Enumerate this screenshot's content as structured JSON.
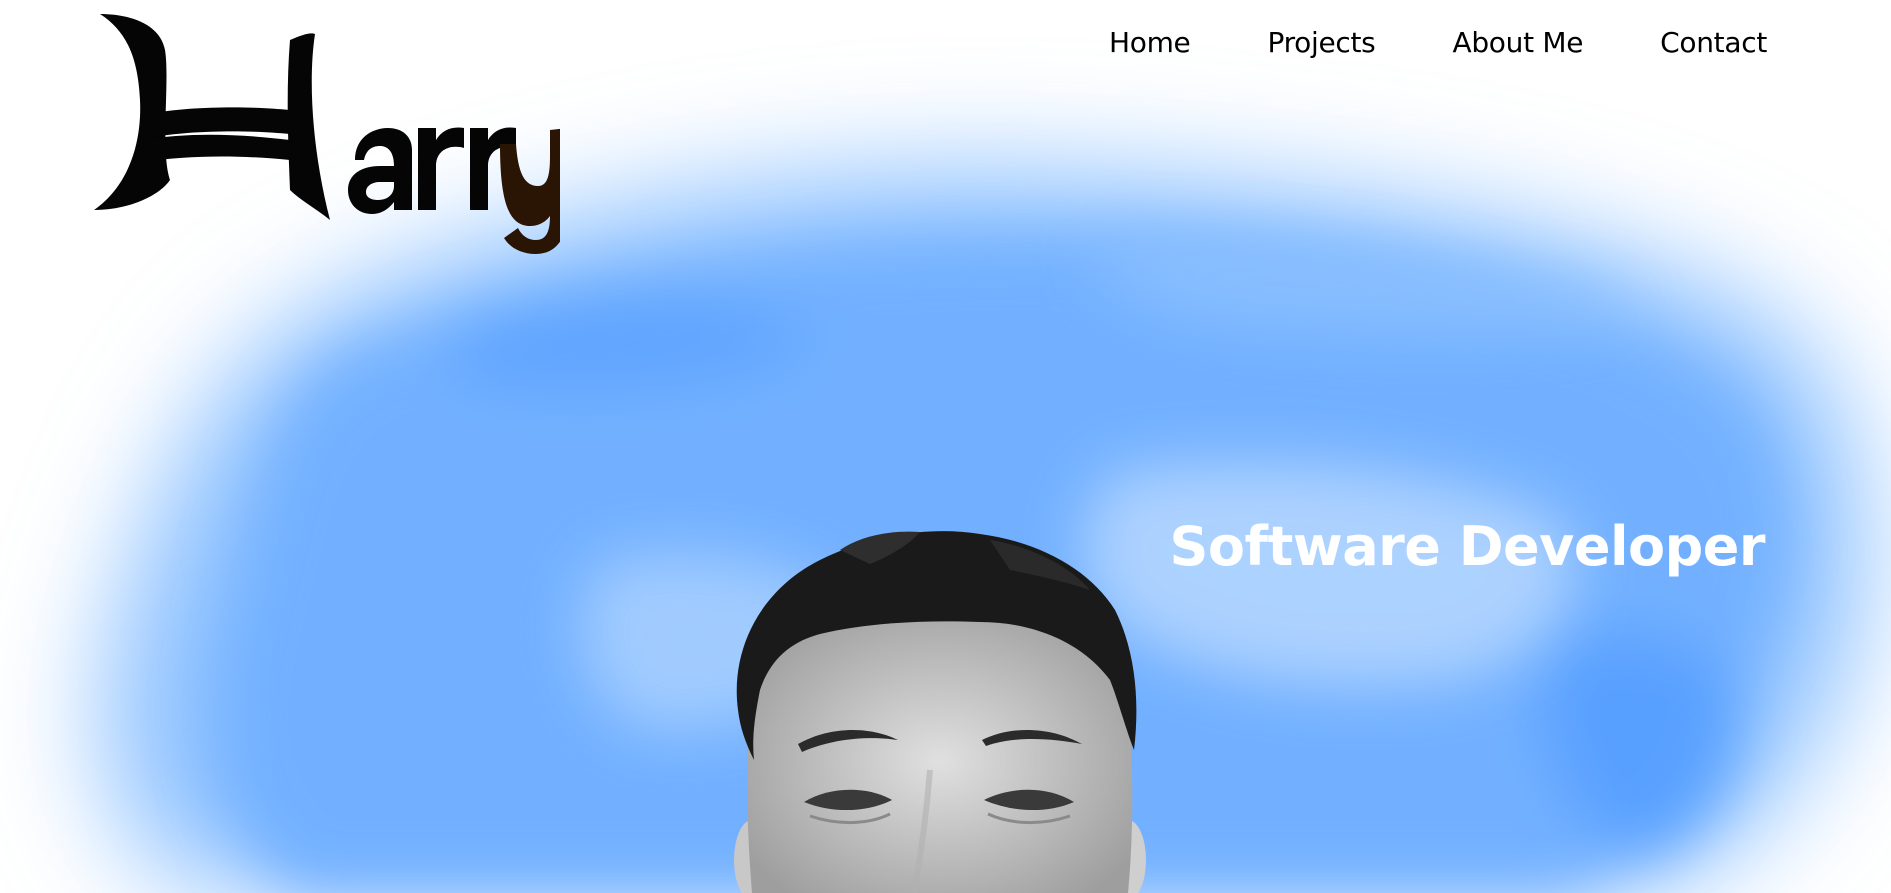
{
  "brand": {
    "logo_text": "Harry"
  },
  "nav": {
    "items": [
      {
        "label": "Home"
      },
      {
        "label": "Projects"
      },
      {
        "label": "About Me"
      },
      {
        "label": "Contact"
      }
    ]
  },
  "hero": {
    "headline": "Software Developer"
  },
  "colors": {
    "sky_deep": "#5aa3ff",
    "sky_light": "#bcdcff",
    "headline": "#ffffff",
    "nav_text": "#000000",
    "logo_black": "#050505",
    "logo_brown": "#2a1505"
  },
  "icons": {
    "logo": "harry-wordmark",
    "portrait": "portrait-photo"
  }
}
